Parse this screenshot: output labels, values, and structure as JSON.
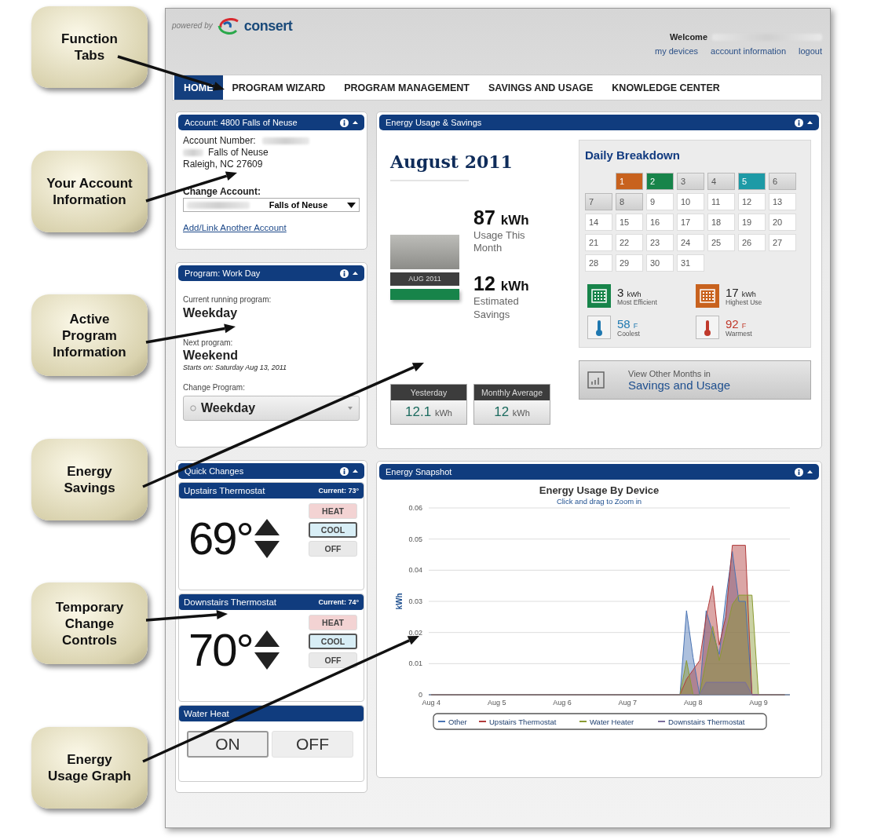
{
  "callouts": [
    "Function Tabs",
    "Your Account Information",
    "Active Program Information",
    "Energy Savings",
    "Temporary Change Controls",
    "Energy Usage Graph"
  ],
  "header": {
    "powered_by": "powered by",
    "logo": "consert",
    "welcome": "Welcome",
    "links": [
      "my devices",
      "account information",
      "logout"
    ]
  },
  "tabs": [
    {
      "label": "HOME",
      "selected": true
    },
    {
      "label": "PROGRAM WIZARD",
      "selected": false
    },
    {
      "label": "PROGRAM MANAGEMENT",
      "selected": false
    },
    {
      "label": "SAVINGS AND USAGE",
      "selected": false
    },
    {
      "label": "KNOWLEDGE CENTER",
      "selected": false
    }
  ],
  "account": {
    "title": "Account: 4800 Falls of Neuse",
    "number_label": "Account Number:",
    "street": "Falls of Neuse",
    "city": "Raleigh, NC 27609",
    "change_label": "Change Account:",
    "select_value": "Falls of Neuse",
    "link": "Add/Link Another Account"
  },
  "program": {
    "title": "Program: Work Day",
    "current_label": "Current running program:",
    "current": "Weekday",
    "next_label": "Next program:",
    "next": "Weekend",
    "starts": "Starts on: Saturday Aug 13, 2011",
    "change_label": "Change Program:",
    "select_value": "Weekday"
  },
  "quick_changes": {
    "title": "Quick Changes",
    "thermostats": [
      {
        "name": "Upstairs Thermostat",
        "current": "Current: 73°",
        "setpoint": "69°",
        "modes": [
          {
            "label": "HEAT",
            "selected": false
          },
          {
            "label": "COOL",
            "selected": true
          },
          {
            "label": "OFF",
            "selected": false
          }
        ]
      },
      {
        "name": "Downstairs Thermostat",
        "current": "Current: 74°",
        "setpoint": "70°",
        "modes": [
          {
            "label": "HEAT",
            "selected": false
          },
          {
            "label": "COOL",
            "selected": true
          },
          {
            "label": "OFF",
            "selected": false
          }
        ]
      }
    ],
    "water_heater": {
      "title": "Water Heat",
      "buttons": [
        {
          "label": "ON",
          "selected": true
        },
        {
          "label": "OFF",
          "selected": false
        }
      ]
    }
  },
  "energy": {
    "title": "Energy Usage & Savings",
    "month": "August 2011",
    "bar_label": "AUG 2011",
    "usage_value": "87",
    "usage_unit": "kWh",
    "usage_label": "Usage This Month",
    "savings_value": "12",
    "savings_unit": "kWh",
    "savings_label": "Estimated Savings",
    "tiles": [
      {
        "label": "Yesterday",
        "value": "12.1",
        "unit": "kWh"
      },
      {
        "label": "Monthly Average",
        "value": "12",
        "unit": "kWh"
      }
    ],
    "breakdown_title": "Daily Breakdown",
    "days": [
      {
        "day": "1",
        "past": true,
        "color": "#c8621e"
      },
      {
        "day": "2",
        "past": true,
        "color": "#17844a"
      },
      {
        "day": "3",
        "past": true
      },
      {
        "day": "4",
        "past": true
      },
      {
        "day": "5",
        "past": true,
        "color": "#1d9aa6"
      },
      {
        "day": "6",
        "past": true
      },
      {
        "day": "7",
        "past": true
      },
      {
        "day": "8",
        "past": true
      },
      {
        "day": "9",
        "past": false
      },
      {
        "day": "10",
        "past": false
      },
      {
        "day": "11",
        "past": false
      },
      {
        "day": "12",
        "past": false
      },
      {
        "day": "13",
        "past": false
      },
      {
        "day": "14",
        "past": false
      },
      {
        "day": "15",
        "past": false
      },
      {
        "day": "16",
        "past": false
      },
      {
        "day": "17",
        "past": false
      },
      {
        "day": "18",
        "past": false
      },
      {
        "day": "19",
        "past": false
      },
      {
        "day": "20",
        "past": false
      },
      {
        "day": "21",
        "past": false
      },
      {
        "day": "22",
        "past": false
      },
      {
        "day": "23",
        "past": false
      },
      {
        "day": "24",
        "past": false
      },
      {
        "day": "25",
        "past": false
      },
      {
        "day": "26",
        "past": false
      },
      {
        "day": "27",
        "past": false
      },
      {
        "day": "28",
        "past": false
      },
      {
        "day": "29",
        "past": false
      },
      {
        "day": "30",
        "past": false
      },
      {
        "day": "31",
        "past": false
      }
    ],
    "stats": [
      {
        "kind": "calendar",
        "color": "#17844a",
        "value": "3",
        "unit": "kWh",
        "label": "Most Efficient"
      },
      {
        "kind": "calendar",
        "color": "#c8621e",
        "value": "17",
        "unit": "kWh",
        "label": "Highest Use"
      },
      {
        "kind": "thermometer",
        "color": "#1f78b0",
        "value": "58",
        "unit": "F",
        "label": "Coolest"
      },
      {
        "kind": "thermometer",
        "color": "#c0392b",
        "value": "92",
        "unit": "F",
        "label": "Warmest"
      }
    ],
    "view_small": "View Other Months in",
    "view_big": "Savings and Usage"
  },
  "snapshot": {
    "title": "Energy Snapshot",
    "chart_data": {
      "type": "area",
      "grid": true,
      "stacked": false,
      "legend": "bottom",
      "title": "Energy Usage By Device",
      "subtitle": "Click and drag to Zoom in",
      "ylabel": "kWh",
      "ylim": [
        0,
        0.06
      ],
      "categories": [
        "Aug 4",
        null,
        null,
        null,
        null,
        null,
        null,
        null,
        null,
        null,
        "Aug 5",
        null,
        null,
        null,
        null,
        null,
        null,
        null,
        null,
        null,
        "Aug 6",
        null,
        null,
        null,
        null,
        null,
        null,
        null,
        null,
        null,
        "Aug 7",
        null,
        null,
        null,
        null,
        null,
        null,
        null,
        null,
        null,
        "Aug 8",
        null,
        null,
        null,
        null,
        null,
        null,
        null,
        null,
        null,
        "Aug 9",
        null,
        null,
        null,
        null
      ],
      "yticks": [
        {
          "value": 0,
          "label": "0"
        },
        {
          "value": 0.01,
          "label": "0.01"
        },
        {
          "value": 0.02,
          "label": "0.02"
        },
        {
          "value": 0.03,
          "label": "0.03"
        },
        {
          "value": 0.04,
          "label": "0.04"
        },
        {
          "value": 0.05,
          "label": "0.05"
        },
        {
          "value": 0.06,
          "label": "0.06"
        }
      ],
      "series": [
        {
          "name": "Other",
          "color": "#4a74b4",
          "values": [
            0,
            0,
            0,
            0,
            0,
            0,
            0,
            0,
            0,
            0,
            0,
            0,
            0,
            0,
            0,
            0,
            0,
            0,
            0,
            0,
            0,
            0,
            0,
            0,
            0,
            0,
            0,
            0,
            0,
            0,
            0,
            0,
            0,
            0,
            0,
            0,
            0,
            0,
            0,
            0.027,
            0.012,
            0,
            0.027,
            0.02,
            0.013,
            0.031,
            0.046,
            0.03,
            0.03,
            0,
            0,
            0,
            0,
            0,
            0
          ]
        },
        {
          "name": "Upstairs Thermostat",
          "color": "#b03a3a",
          "values": [
            0,
            0,
            0,
            0,
            0,
            0,
            0,
            0,
            0,
            0,
            0,
            0,
            0,
            0,
            0,
            0,
            0,
            0,
            0,
            0,
            0,
            0,
            0,
            0,
            0,
            0,
            0,
            0,
            0,
            0,
            0,
            0,
            0,
            0,
            0,
            0,
            0,
            0,
            0,
            0.005,
            0.008,
            0.011,
            0.025,
            0.035,
            0.016,
            0.025,
            0.048,
            0.048,
            0.048,
            0,
            0,
            0,
            0,
            0,
            0
          ]
        },
        {
          "name": "Water Heater",
          "color": "#8a9a32",
          "values": [
            0,
            0,
            0,
            0,
            0,
            0,
            0,
            0,
            0,
            0,
            0,
            0,
            0,
            0,
            0,
            0,
            0,
            0,
            0,
            0,
            0,
            0,
            0,
            0,
            0,
            0,
            0,
            0,
            0,
            0,
            0,
            0,
            0,
            0,
            0,
            0,
            0,
            0,
            0,
            0.011,
            0,
            0,
            0.011,
            0.022,
            0.011,
            0.02,
            0.029,
            0.032,
            0.032,
            0.032,
            0,
            0,
            0,
            0,
            0
          ]
        },
        {
          "name": "Downstairs Thermostat",
          "color": "#7a6e9c",
          "values": [
            0,
            0,
            0,
            0,
            0,
            0,
            0,
            0,
            0,
            0,
            0,
            0,
            0,
            0,
            0,
            0,
            0,
            0,
            0,
            0,
            0,
            0,
            0,
            0,
            0,
            0,
            0,
            0,
            0,
            0,
            0,
            0,
            0,
            0,
            0,
            0,
            0,
            0,
            0,
            0,
            0,
            0,
            0.004,
            0.004,
            0.004,
            0.004,
            0.004,
            0.004,
            0.004,
            0,
            0,
            0,
            0,
            0,
            0
          ]
        }
      ]
    }
  }
}
